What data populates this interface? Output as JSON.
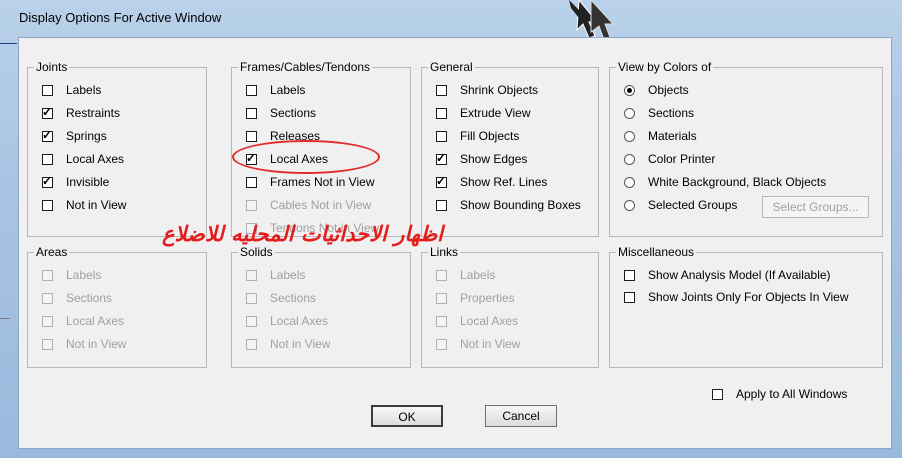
{
  "window": {
    "title": "Display Options For Active Window"
  },
  "joints": {
    "title": "Joints",
    "items": [
      {
        "label": "Labels",
        "checked": false
      },
      {
        "label": "Restraints",
        "checked": true
      },
      {
        "label": "Springs",
        "checked": true
      },
      {
        "label": "Local Axes",
        "checked": false
      },
      {
        "label": "Invisible",
        "checked": true
      },
      {
        "label": "Not in View",
        "checked": false
      }
    ]
  },
  "frames": {
    "title": "Frames/Cables/Tendons",
    "items": [
      {
        "label": "Labels",
        "checked": false
      },
      {
        "label": "Sections",
        "checked": false
      },
      {
        "label": "Releases",
        "checked": false
      },
      {
        "label": "Local Axes",
        "checked": true
      },
      {
        "label": "Frames Not in View",
        "checked": false
      },
      {
        "label": "Cables Not in View",
        "checked": false,
        "disabled": true
      },
      {
        "label": "Tendons Not in View",
        "checked": false,
        "disabled": true
      }
    ]
  },
  "general": {
    "title": "General",
    "items": [
      {
        "label": "Shrink Objects",
        "checked": false
      },
      {
        "label": "Extrude View",
        "checked": false
      },
      {
        "label": "Fill Objects",
        "checked": false
      },
      {
        "label": "Show Edges",
        "checked": true
      },
      {
        "label": "Show Ref. Lines",
        "checked": true
      },
      {
        "label": "Show Bounding Boxes",
        "checked": false
      }
    ]
  },
  "view_by_colors": {
    "title": "View by Colors of",
    "items": [
      {
        "label": "Objects",
        "selected": true
      },
      {
        "label": "Sections",
        "selected": false
      },
      {
        "label": "Materials",
        "selected": false
      },
      {
        "label": "Color Printer",
        "selected": false
      },
      {
        "label": "White Background, Black Objects",
        "selected": false
      },
      {
        "label": "Selected Groups",
        "selected": false
      }
    ],
    "select_groups_button": "Select Groups..."
  },
  "areas": {
    "title": "Areas",
    "items": [
      "Labels",
      "Sections",
      "Local Axes",
      "Not in View"
    ]
  },
  "solids": {
    "title": "Solids",
    "items": [
      "Labels",
      "Sections",
      "Local Axes",
      "Not in View"
    ]
  },
  "links": {
    "title": "Links",
    "items": [
      "Labels",
      "Properties",
      "Local Axes",
      "Not in View"
    ]
  },
  "misc": {
    "title": "Miscellaneous",
    "items": [
      {
        "label": "Show Analysis Model  (If Available)",
        "checked": false
      },
      {
        "label": "Show Joints Only For Objects In View",
        "checked": false
      }
    ]
  },
  "apply_all": {
    "label": "Apply to All Windows",
    "checked": false
  },
  "buttons": {
    "ok": "OK",
    "cancel": "Cancel"
  },
  "annotation": {
    "arabic_text": "اظهار الاحداثيات المحليه للاضلاع",
    "color": "#e51c1c"
  },
  "colors": {
    "title_bar": "#b9d1ea",
    "dialog_bg": "#f0f0f0",
    "annotation": "#e32a2a"
  }
}
